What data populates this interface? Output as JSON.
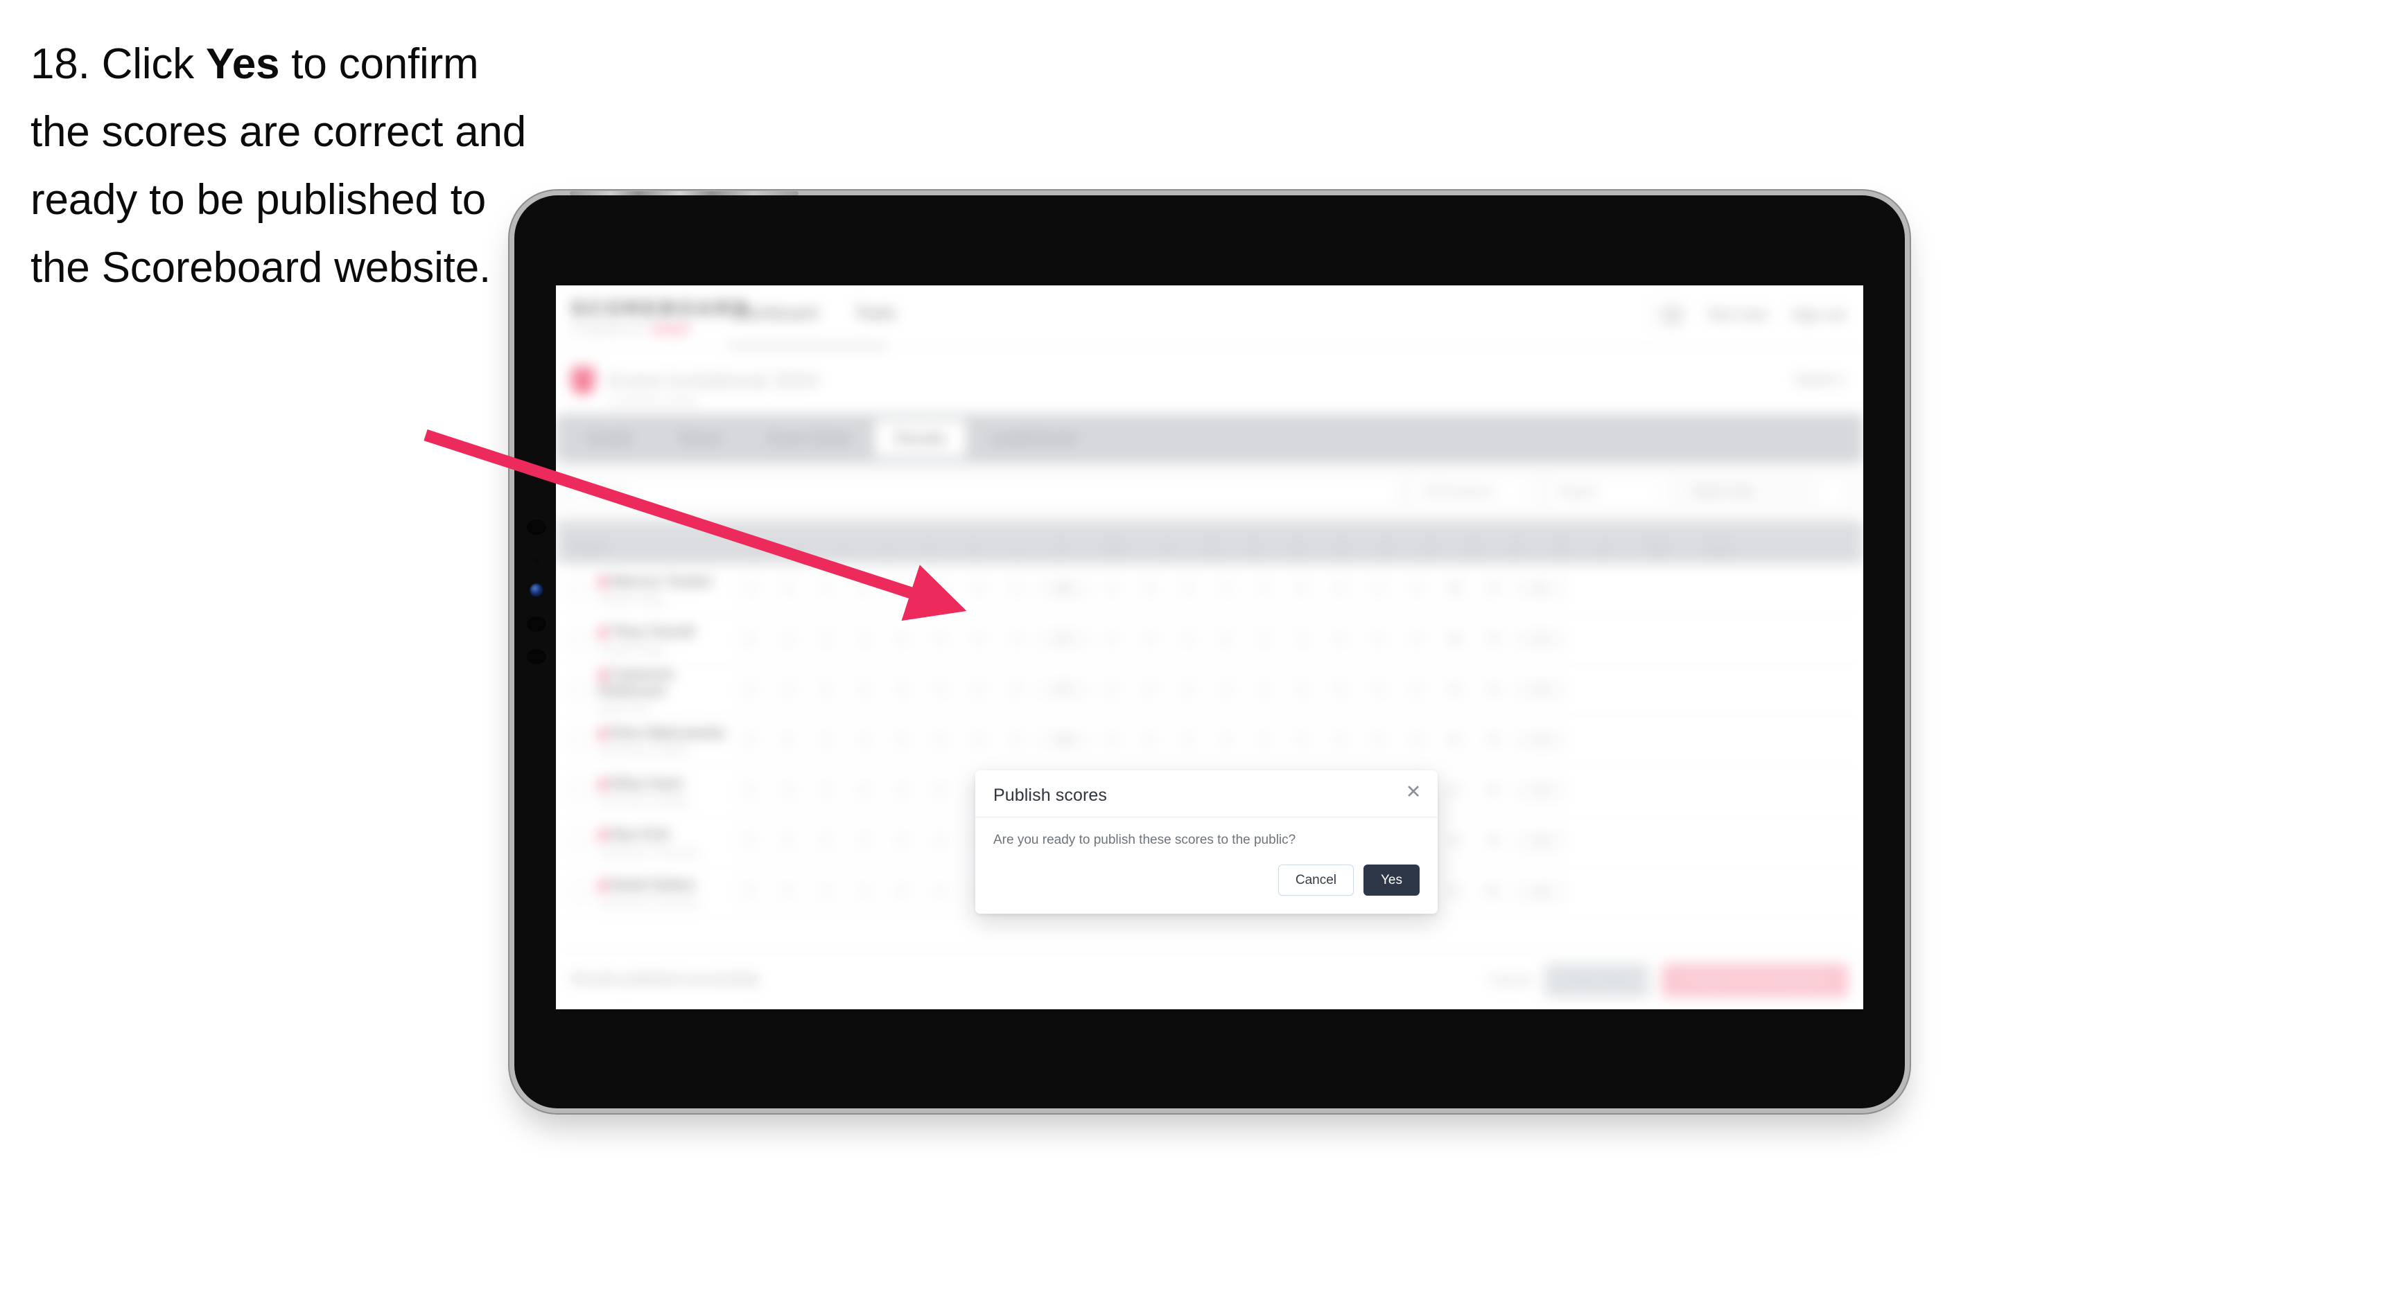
{
  "instruction": {
    "number": "18.",
    "before_bold": "Click ",
    "bold": "Yes",
    "after_bold": " to confirm the scores are correct and ready to be published to the Scoreboard website."
  },
  "annotation": {
    "arrow_color": "#EC2A5B",
    "points_to": "yes-button"
  },
  "app": {
    "logo": "SCOREBOARD",
    "logo_sub": "POWERED BY",
    "logo_sub_accent": "SPORT",
    "nav": [
      "Dashboard",
      "Tools"
    ],
    "header_right": [
      "Test User",
      "Sign out"
    ],
    "event": {
      "title": "Event Invitational",
      "title_suffix": "2024",
      "subtitle": "Competition details",
      "right_label": "Event 1"
    },
    "tabs": [
      {
        "label": "Details",
        "active": false
      },
      {
        "label": "Teams",
        "active": false
      },
      {
        "label": "Score Sheet",
        "active": false
      },
      {
        "label": "Results",
        "active": true
      },
      {
        "label": "Leaderboard",
        "active": false
      }
    ],
    "filters": {
      "search_placeholder": "Search",
      "selects": [
        {
          "label": "All Divisions"
        },
        {
          "label": "Report"
        },
        {
          "label": "Table Only"
        }
      ]
    },
    "table": {
      "columns": [
        {
          "label": "Player",
          "type": "player"
        },
        {
          "label": "1",
          "type": "num"
        },
        {
          "label": "2",
          "type": "num"
        },
        {
          "label": "3",
          "type": "num"
        },
        {
          "label": "4",
          "type": "num"
        },
        {
          "label": "5",
          "type": "num"
        },
        {
          "label": "6",
          "type": "num"
        },
        {
          "label": "7",
          "type": "num"
        },
        {
          "label": "8",
          "type": "num"
        },
        {
          "label": "Sub",
          "type": "wide"
        },
        {
          "label": "9",
          "type": "num"
        },
        {
          "label": "10",
          "type": "num"
        },
        {
          "label": "11",
          "type": "num"
        },
        {
          "label": "12",
          "type": "num"
        },
        {
          "label": "13",
          "type": "num"
        },
        {
          "label": "14",
          "type": "num"
        },
        {
          "label": "15",
          "type": "num"
        },
        {
          "label": "16",
          "type": "num"
        },
        {
          "label": "17",
          "type": "num"
        },
        {
          "label": "18",
          "type": "num"
        },
        {
          "label": "In",
          "type": "num"
        },
        {
          "label": "Total",
          "type": "wide"
        },
        {
          "label": "Score",
          "type": "wide"
        }
      ],
      "rows": [
        {
          "name": "Marcus Tucker",
          "team": "Oakleaf Ridge",
          "scores": [
            "4",
            "5",
            "4",
            "3",
            "5",
            "4",
            "4",
            "3",
            "36",
            "4",
            "5",
            "3",
            "4",
            "4",
            "5",
            "4",
            "3",
            "4",
            "36",
            "72",
            "E"
          ]
        },
        {
          "name": "Theo Farrell",
          "team": "Oakleaf Ridge",
          "scores": [
            "5",
            "4",
            "4",
            "4",
            "4",
            "5",
            "3",
            "4",
            "37",
            "4",
            "4",
            "4",
            "5",
            "3",
            "4",
            "4",
            "4",
            "4",
            "36",
            "73",
            "+1"
          ]
        },
        {
          "name": "Cameron Robinson",
          "team": "Bellet Park",
          "scores": [
            "4",
            "4",
            "5",
            "3",
            "4",
            "4",
            "4",
            "5",
            "37",
            "5",
            "4",
            "4",
            "4",
            "4",
            "3",
            "5",
            "4",
            "4",
            "37",
            "74",
            "+2"
          ]
        },
        {
          "name": "Dion Matsumoto",
          "team": "Summerton Athletic",
          "scores": [
            "4",
            "5",
            "3",
            "4",
            "5",
            "4",
            "5",
            "4",
            "38",
            "4",
            "4",
            "5",
            "3",
            "4",
            "5",
            "4",
            "4",
            "4",
            "37",
            "75",
            "+3"
          ]
        },
        {
          "name": "Elias Hunt",
          "team": "Summerton Athletic",
          "scores": [
            "5",
            "4",
            "4",
            "5",
            "4",
            "5",
            "4",
            "4",
            "39",
            "4",
            "5",
            "4",
            "4",
            "5",
            "4",
            "4",
            "4",
            "3",
            "37",
            "76",
            "+4"
          ]
        },
        {
          "name": "Ryo Kim",
          "team": "Lakespoint University",
          "scores": [
            "4",
            "5",
            "5",
            "4",
            "4",
            "4",
            "5",
            "4",
            "39",
            "5",
            "4",
            "4",
            "5",
            "4",
            "4",
            "4",
            "5",
            "4",
            "39",
            "78",
            "+6"
          ]
        },
        {
          "name": "Noah Dukes",
          "team": "Lakespoint University",
          "scores": [
            "5",
            "5",
            "4",
            "4",
            "5",
            "4",
            "4",
            "5",
            "40",
            "4",
            "5",
            "5",
            "4",
            "4",
            "5",
            "4",
            "4",
            "5",
            "40",
            "80",
            "+8"
          ]
        }
      ]
    },
    "footer": {
      "note": "Results published successfully",
      "link": "Cancel",
      "secondary_button": "Save draft",
      "primary_button": "Publish to Scoreboard"
    }
  },
  "modal": {
    "title": "Publish scores",
    "close_icon": "close-icon",
    "body": "Are you ready to publish these scores to the public?",
    "cancel_label": "Cancel",
    "yes_label": "Yes",
    "yes_color": "#2E3748"
  }
}
